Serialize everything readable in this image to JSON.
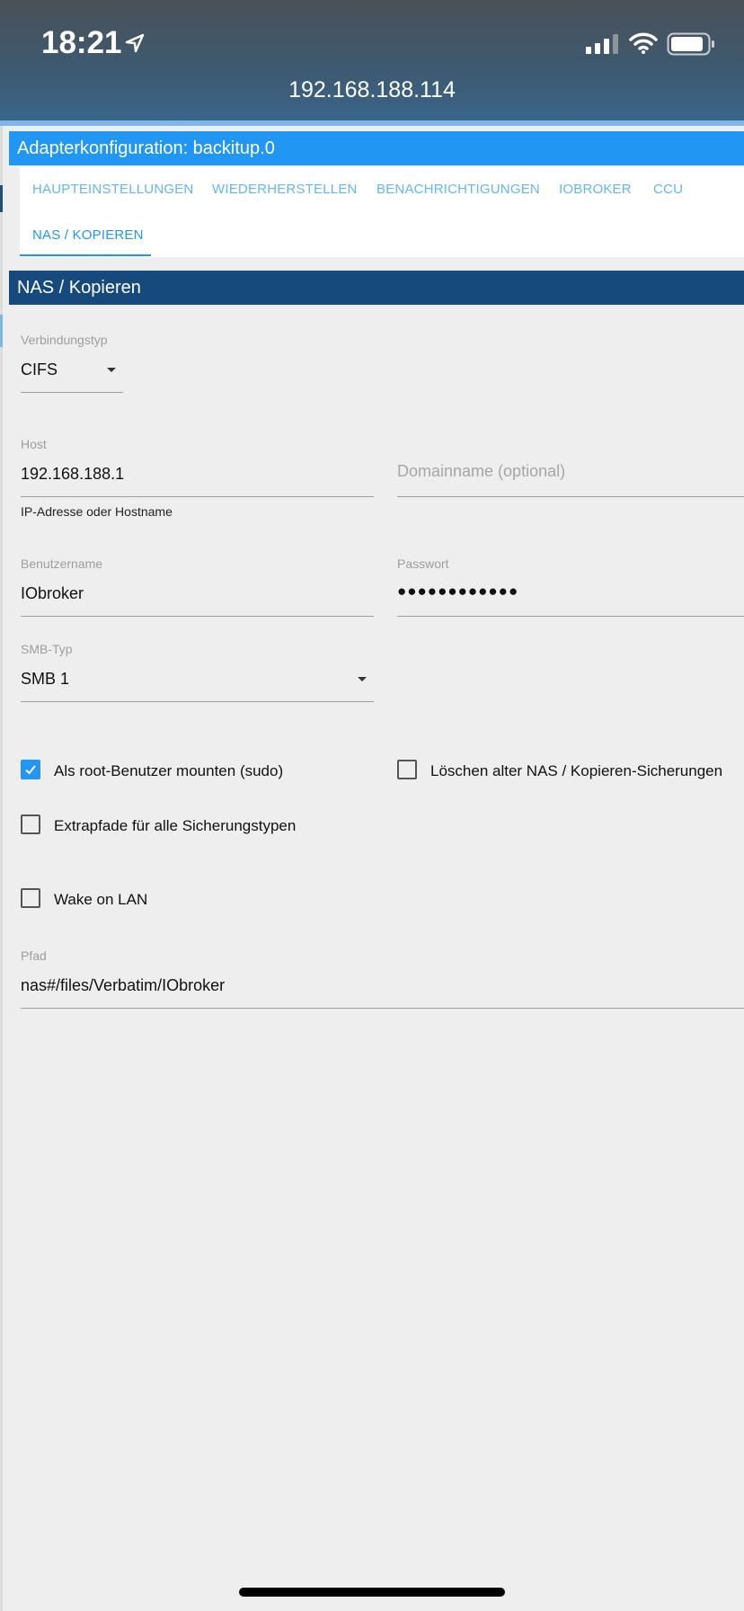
{
  "status_bar": {
    "time": "18:21"
  },
  "browser": {
    "address": "192.168.188.114"
  },
  "adapter": {
    "title": "Adapterkonfiguration: backitup.0"
  },
  "tabs": [
    {
      "label": "HAUPTEINSTELLUNGEN"
    },
    {
      "label": "WIEDERHERSTELLEN"
    },
    {
      "label": "BENACHRICHTIGUNGEN"
    },
    {
      "label": "IOBROKER"
    },
    {
      "label": "CCU"
    },
    {
      "label": "NAS / KOPIEREN",
      "active": true
    }
  ],
  "section": {
    "title": "NAS / Kopieren"
  },
  "form": {
    "connection_type": {
      "label": "Verbindungstyp",
      "value": "CIFS"
    },
    "host": {
      "label": "Host",
      "value": "192.168.188.1",
      "helper": "IP-Adresse oder Hostname"
    },
    "domain": {
      "placeholder": "Domainname (optional)"
    },
    "username": {
      "label": "Benutzername",
      "value": "IObroker"
    },
    "password": {
      "label": "Passwort",
      "value": "●●●●●●●●●●●●"
    },
    "smb_type": {
      "label": "SMB-Typ",
      "value": "SMB 1"
    },
    "sudo": {
      "label": "Als root-Benutzer mounten (sudo)",
      "checked": true
    },
    "delete_old": {
      "label": "Löschen alter NAS / Kopieren-Sicherungen",
      "checked": false
    },
    "extra_paths": {
      "label": "Extrapfade für alle Sicherungstypen",
      "checked": false
    },
    "wol": {
      "label": "Wake on LAN",
      "checked": false
    },
    "path": {
      "label": "Pfad",
      "value": "nas#/files/Verbatim/IObroker"
    }
  },
  "colors": {
    "primary": "#2196f3",
    "section": "#164a7c",
    "tab": "#64b5f6"
  }
}
